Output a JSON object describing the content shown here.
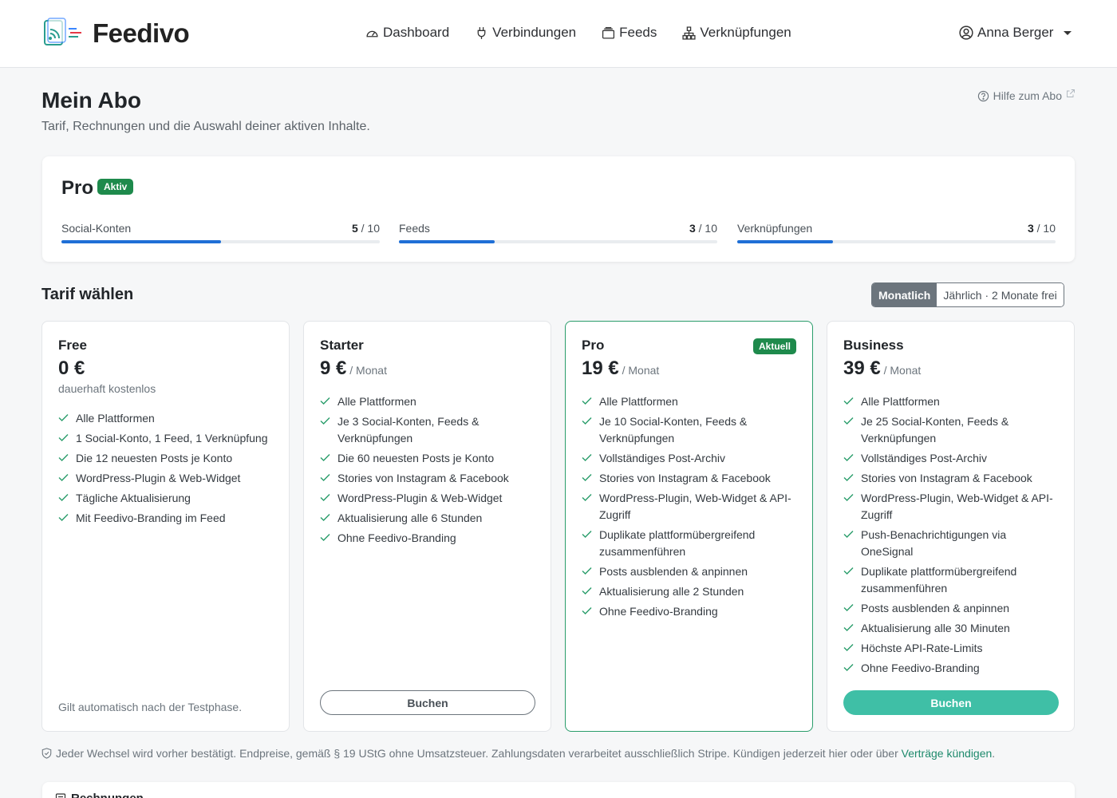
{
  "app": {
    "brand": "Feedivo"
  },
  "nav": {
    "items": [
      {
        "label": "Dashboard",
        "icon": "speedometer-icon"
      },
      {
        "label": "Verbindungen",
        "icon": "plug-icon"
      },
      {
        "label": "Feeds",
        "icon": "feeds-icon"
      },
      {
        "label": "Verknüpfungen",
        "icon": "sitemap-icon"
      }
    ],
    "user": "Anna Berger"
  },
  "page": {
    "title": "Mein Abo",
    "subtitle": "Tarif, Rechnungen und die Auswahl deiner aktiven Inhalte.",
    "help": "Hilfe zum Abo"
  },
  "current_plan": {
    "name": "Pro",
    "badge": "Aktiv",
    "meters": [
      {
        "label": "Social-Konten",
        "used": "5",
        "limit": " / 10",
        "fraction": 0.5
      },
      {
        "label": "Feeds",
        "used": "3",
        "limit": " / 10",
        "fraction": 0.3
      },
      {
        "label": "Verknüpfungen",
        "used": "3",
        "limit": " / 10",
        "fraction": 0.3
      }
    ]
  },
  "tariffs": {
    "title": "Tarif wählen",
    "toggle": {
      "monthly": "Monatlich",
      "yearly": "Jährlich · 2 Monate frei",
      "selected": "monthly"
    },
    "plans": [
      {
        "name": "Free",
        "price": "0 €",
        "per": "",
        "note": "dauerhaft kostenlos",
        "features": [
          "Alle Plattformen",
          "1 Social-Konto, 1 Feed, 1 Verknüpfung",
          "Die 12 neuesten Posts je Konto",
          "WordPress-Plugin & Web-Widget",
          "Tägliche Aktualisierung",
          "Mit Feedivo-Branding im Feed"
        ],
        "footer": "Gilt automatisch nach der Testphase."
      },
      {
        "name": "Starter",
        "price": "9 €",
        "per": " / Monat",
        "features": [
          "Alle Plattformen",
          "Je 3 Social-Konten, Feeds & Verknüpfungen",
          "Die 60 neuesten Posts je Konto",
          "Stories von Instagram & Facebook",
          "WordPress-Plugin & Web-Widget",
          "Aktualisierung alle 6 Stunden",
          "Ohne Feedivo-Branding"
        ],
        "button": "Buchen"
      },
      {
        "name": "Pro",
        "price": "19 €",
        "per": " / Monat",
        "badge": "Aktuell",
        "features": [
          "Alle Plattformen",
          "Je 10 Social-Konten, Feeds & Verknüpfungen",
          "Vollständiges Post-Archiv",
          "Stories von Instagram & Facebook",
          "WordPress-Plugin, Web-Widget & API-Zugriff",
          "Duplikate plattformübergreifend zusammenführen",
          "Posts ausblenden & anpinnen",
          "Aktualisierung alle 2 Stunden",
          "Ohne Feedivo-Branding"
        ]
      },
      {
        "name": "Business",
        "price": "39 €",
        "per": " / Monat",
        "features": [
          "Alle Plattformen",
          "Je 25 Social-Konten, Feeds & Verknüpfungen",
          "Vollständiges Post-Archiv",
          "Stories von Instagram & Facebook",
          "WordPress-Plugin, Web-Widget & API-Zugriff",
          "Push-Benachrichtigungen via OneSignal",
          "Duplikate plattformübergreifend zusammenführen",
          "Posts ausblenden & anpinnen",
          "Aktualisierung alle 30 Minuten",
          "Höchste API-Rate-Limits",
          "Ohne Feedivo-Branding"
        ],
        "button": "Buchen"
      }
    ]
  },
  "legal": {
    "text": "Jeder Wechsel wird vorher bestätigt. Endpreise, gemäß § 19 UStG ohne Umsatzsteuer. Zahlungsdaten verarbeitet ausschließlich Stripe. Kündigen jederzeit hier oder über ",
    "link": "Verträge kündigen",
    "end": "."
  },
  "invoices": {
    "title": "Rechnungen"
  },
  "colors": {
    "accent_green": "#1e8a4c",
    "progress_blue": "#1f6fd6",
    "button_teal": "#3fbfa6",
    "check_green": "#2a9d6b"
  }
}
